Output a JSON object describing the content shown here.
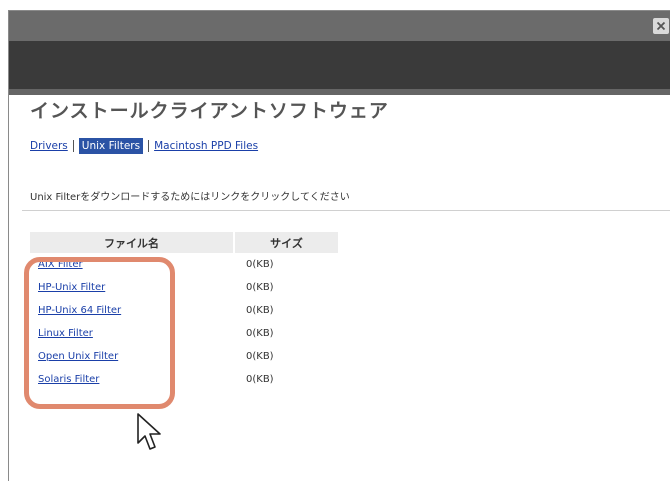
{
  "page": {
    "title": "インストールクライアントソフトウェア",
    "instruction": "Unix Filterをダウンロードするためにはリンクをクリックしてください"
  },
  "tabs": [
    {
      "label": "Drivers",
      "active": false
    },
    {
      "label": "Unix Filters",
      "active": true
    },
    {
      "label": "Macintosh PPD Files",
      "active": false
    }
  ],
  "table": {
    "headers": {
      "name": "ファイル名",
      "size": "サイズ"
    },
    "rows": [
      {
        "name": "AIX Filter",
        "size": "0(KB)"
      },
      {
        "name": "HP-Unix Filter",
        "size": "0(KB)"
      },
      {
        "name": "HP-Unix 64 Filter",
        "size": "0(KB)"
      },
      {
        "name": "Linux Filter",
        "size": "0(KB)"
      },
      {
        "name": "Open Unix Filter",
        "size": "0(KB)"
      },
      {
        "name": "Solaris Filter",
        "size": "0(KB)"
      }
    ]
  },
  "icons": {
    "close": "close-icon",
    "cursor": "mouse-pointer-icon"
  },
  "colors": {
    "link": "#1a3fa8",
    "active_tab": "#2b53a5",
    "highlight": "#e0896e",
    "header_bar": "#3a3a3a",
    "titlebar": "#6b6b6b"
  }
}
